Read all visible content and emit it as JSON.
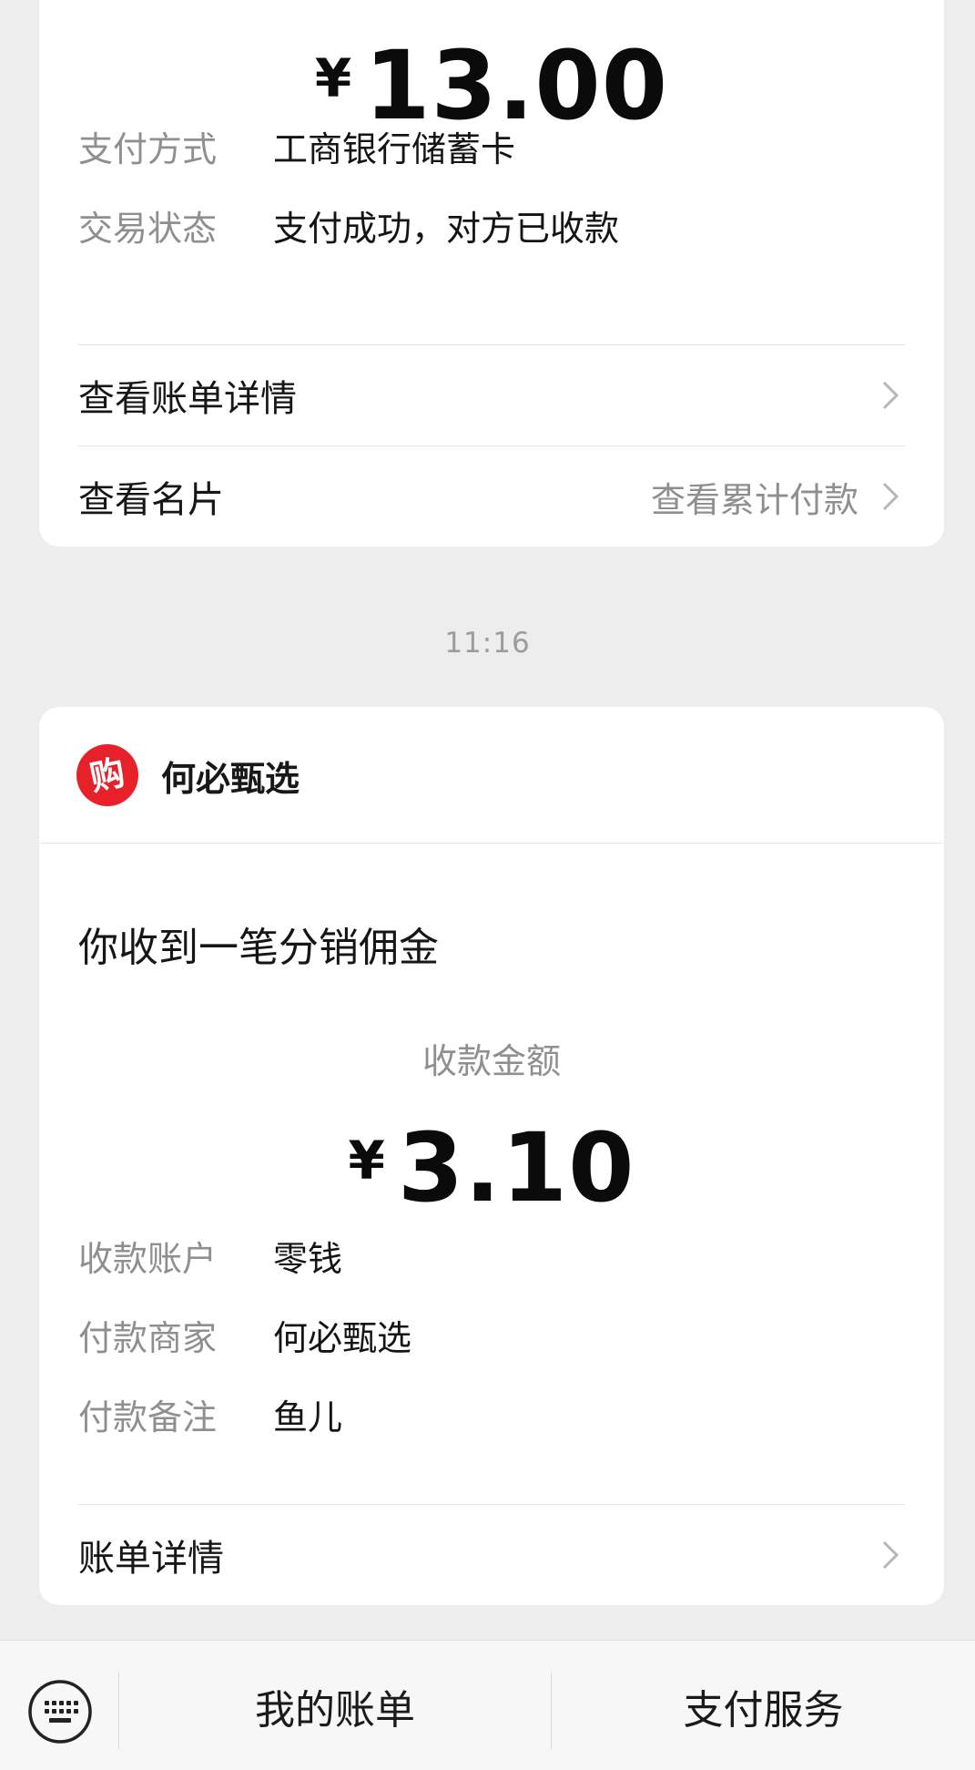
{
  "card1": {
    "amount_symbol": "¥",
    "amount_value": "13.00",
    "details": [
      {
        "label": "支付方式",
        "value": "工商银行储蓄卡"
      },
      {
        "label": "交易状态",
        "value": "支付成功，对方已收款"
      }
    ],
    "bill_details_label": "查看账单详情",
    "card_label": "查看名片",
    "cumulative_label": "查看累计付款"
  },
  "timestamp": "11:16",
  "card2": {
    "merchant_name": "何必甄选",
    "logo_glyph": "购",
    "logo_color": "#e62129",
    "headline": "你收到一笔分销佣金",
    "amount_title": "收款金额",
    "amount_symbol": "¥",
    "amount_value": "3.10",
    "details": [
      {
        "label": "收款账户",
        "value": "零钱"
      },
      {
        "label": "付款商家",
        "value": "何必甄选"
      },
      {
        "label": "付款备注",
        "value": "鱼儿"
      }
    ],
    "bill_details_label": "账单详情"
  },
  "bottom_bar": {
    "keyboard_icon": "keyboard-icon",
    "menu_items": [
      {
        "label": "我的账单"
      },
      {
        "label": "支付服务"
      }
    ]
  }
}
